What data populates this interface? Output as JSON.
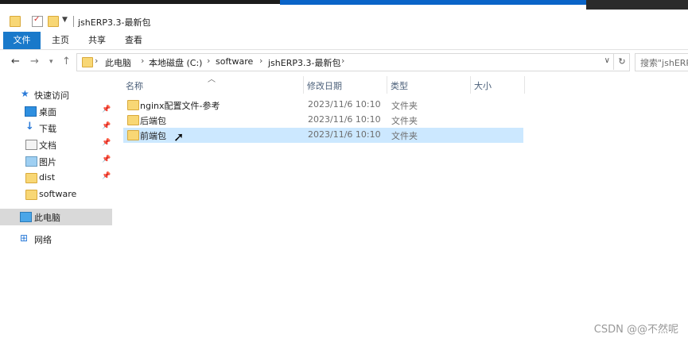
{
  "window": {
    "title": "jshERP3.3-最新包"
  },
  "ribbon": {
    "tabs": [
      "文件",
      "主页",
      "共享",
      "查看"
    ]
  },
  "address": {
    "crumbs": [
      "此电脑",
      "本地磁盘 (C:)",
      "software",
      "jshERP3.3-最新包"
    ],
    "search_placeholder": "搜索\"jshERP3..."
  },
  "sidebar": {
    "items": [
      {
        "label": "快速访问",
        "icon": "star-icon",
        "pinned": false
      },
      {
        "label": "桌面",
        "icon": "desktop-icon",
        "pinned": true
      },
      {
        "label": "下载",
        "icon": "download-icon",
        "pinned": true
      },
      {
        "label": "文档",
        "icon": "document-icon",
        "pinned": true
      },
      {
        "label": "图片",
        "icon": "pictures-icon",
        "pinned": true
      },
      {
        "label": "dist",
        "icon": "folder-icon",
        "pinned": true
      },
      {
        "label": "software",
        "icon": "folder-icon",
        "pinned": false
      },
      {
        "label": "此电脑",
        "icon": "computer-icon",
        "pinned": false,
        "selected": true
      },
      {
        "label": "网络",
        "icon": "network-icon",
        "pinned": false
      }
    ]
  },
  "file_list": {
    "columns": [
      "名称",
      "修改日期",
      "类型",
      "大小"
    ],
    "rows": [
      {
        "name": "nginx配置文件-参考",
        "date": "2023/11/6 10:10",
        "type": "文件夹"
      },
      {
        "name": "后端包",
        "date": "2023/11/6 10:10",
        "type": "文件夹"
      },
      {
        "name": "前端包",
        "date": "2023/11/6 10:10",
        "type": "文件夹",
        "selected": true
      }
    ]
  },
  "watermark": "CSDN @@不然呢",
  "colors": {
    "accent": "#1979ca",
    "selection": "#cce8ff",
    "folder": "#f8d775"
  }
}
